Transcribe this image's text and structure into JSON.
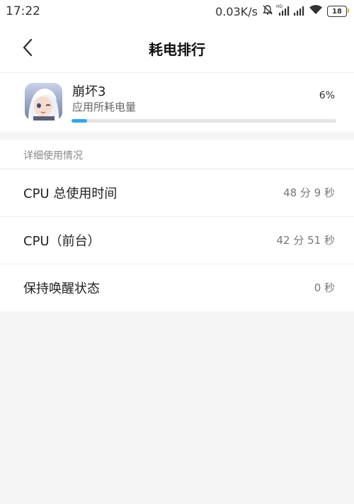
{
  "status_bar": {
    "time": "17:22",
    "network_speed": "0.03K/s",
    "battery_level": "18",
    "icons": [
      "mute-icon",
      "hd-signal-icon",
      "signal-icon",
      "wifi-icon",
      "battery-icon"
    ]
  },
  "header": {
    "title": "耗电排行"
  },
  "app": {
    "name": "崩坏3",
    "subtitle": "应用所耗电量",
    "percent": "6%",
    "progress_percent": 6,
    "progress_color": "#33a5f2"
  },
  "details": {
    "section_title": "详细使用情况",
    "rows": [
      {
        "label": "CPU 总使用时间",
        "value": "48 分 9 秒"
      },
      {
        "label": "CPU（前台）",
        "value": "42 分 51 秒"
      },
      {
        "label": "保持唤醒状态",
        "value": "0 秒"
      }
    ]
  }
}
